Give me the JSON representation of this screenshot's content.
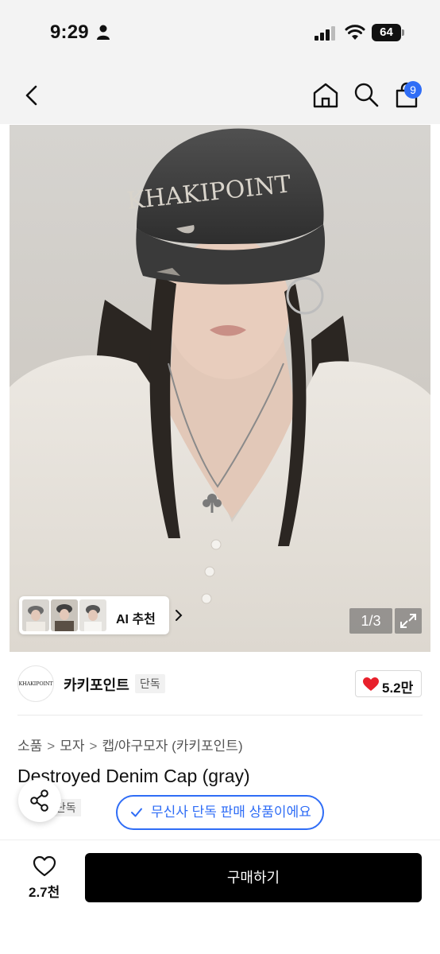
{
  "status_bar": {
    "time": "9:29",
    "battery": "64"
  },
  "nav": {
    "cart_count": "9"
  },
  "gallery": {
    "ai_label": "AI 추천",
    "page_indicator": "1/3",
    "cap_text": "KHAKIPOINT"
  },
  "brand": {
    "logo_text": "KHAKIPOINT",
    "name": "카키포인트",
    "tag": "단독",
    "like_count": "5.2만"
  },
  "breadcrumb": [
    "소품",
    "모자",
    "캡/야구모자 (카키포인트)"
  ],
  "product": {
    "title": "Destroyed Denim Cap (gray)",
    "exclusive_tag": "단독",
    "exclusive_notice": "무신사 단독 판매 상품이에요"
  },
  "bottom_bar": {
    "wish_count": "2.7천",
    "buy_label": "구매하기"
  },
  "colors": {
    "accent": "#2f6df6",
    "heart": "#e8202b",
    "buy_button": "#000000"
  }
}
